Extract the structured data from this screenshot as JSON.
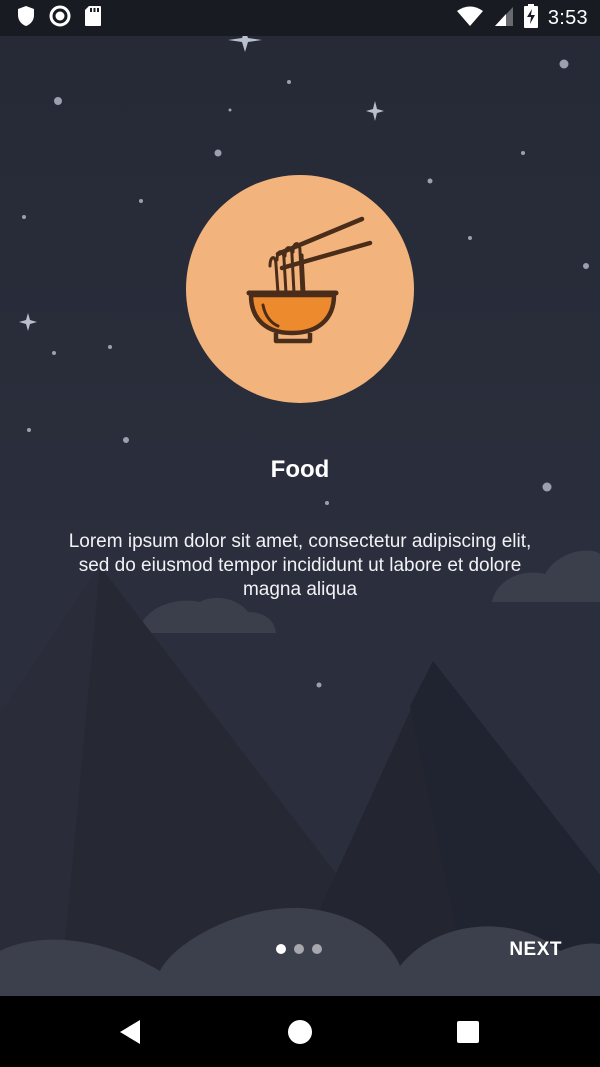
{
  "status_bar": {
    "time": "3:53",
    "left_icons": [
      "shield-icon",
      "record-icon",
      "sd-card-icon"
    ],
    "right_icons": [
      "wifi-icon",
      "signal-icon",
      "battery-charging-icon"
    ]
  },
  "onboarding": {
    "title": "Food",
    "description": "Lorem ipsum dolor sit amet, consectetur adipiscing elit, sed do eiusmod tempor incididunt ut labore et dolore magna aliqua",
    "hero_icon": "noodle-bowl-icon",
    "page_indicator": {
      "current": 1,
      "total": 3
    },
    "next_label": "NEXT"
  },
  "nav_bar": {
    "buttons": [
      "back-icon",
      "home-icon",
      "recents-icon"
    ]
  },
  "colors": {
    "background": "#2b2f3d",
    "hero_circle": "#f2b47c",
    "bowl": "#ee8a2e",
    "outline": "#4a2c1a",
    "text": "#ffffff"
  }
}
